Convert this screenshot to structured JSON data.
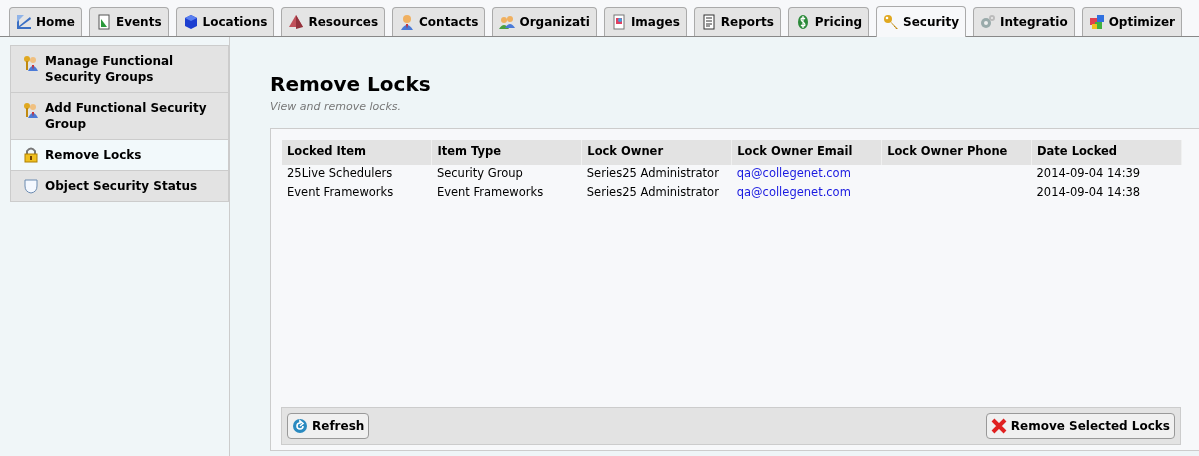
{
  "tabs": [
    {
      "label": "Home",
      "selected": false
    },
    {
      "label": "Events",
      "selected": false
    },
    {
      "label": "Locations",
      "selected": false
    },
    {
      "label": "Resources",
      "selected": false
    },
    {
      "label": "Contacts",
      "selected": false
    },
    {
      "label": "Organizati",
      "selected": false
    },
    {
      "label": "Images",
      "selected": false
    },
    {
      "label": "Reports",
      "selected": false
    },
    {
      "label": "Pricing",
      "selected": false
    },
    {
      "label": "Security",
      "selected": true
    },
    {
      "label": "Integratio",
      "selected": false
    },
    {
      "label": "Optimizer",
      "selected": false
    }
  ],
  "sidebar": {
    "items": [
      {
        "label": "Manage Functional Security Groups",
        "kind": "group",
        "selected": false
      },
      {
        "label": "Add Functional Security Group",
        "kind": "group",
        "selected": false
      },
      {
        "label": "Remove Locks",
        "kind": "lock",
        "selected": true
      },
      {
        "label": "Object Security Status",
        "kind": "shield",
        "selected": false
      }
    ]
  },
  "page": {
    "title": "Remove Locks",
    "subtitle": "View and remove locks."
  },
  "table": {
    "columns": [
      "Locked Item",
      "Item Type",
      "Lock Owner",
      "Lock Owner Email",
      "Lock Owner Phone",
      "Date Locked"
    ],
    "rows": [
      [
        "25Live Schedulers",
        "Security Group",
        "Series25 Administrator",
        "qa@collegenet.com",
        "",
        "2014-09-04 14:39"
      ],
      [
        "Event Frameworks",
        "Event Frameworks",
        "Series25 Administrator",
        "qa@collegenet.com",
        "",
        "2014-09-04 14:38"
      ]
    ]
  },
  "buttons": {
    "refresh": "Refresh",
    "remove": "Remove Selected Locks"
  }
}
